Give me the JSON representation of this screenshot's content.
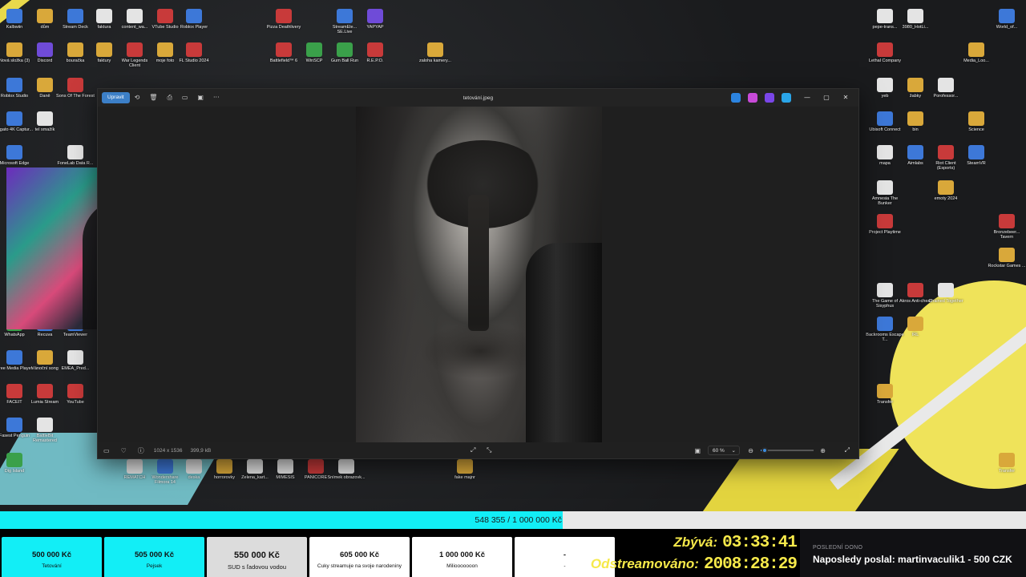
{
  "desktop": {
    "icons": [
      {
        "label": "Kalbwiin",
        "color": "blue"
      },
      {
        "label": "dům",
        "color": "folder"
      },
      {
        "label": "Stream Deck",
        "color": "blue"
      },
      {
        "label": "faktura",
        "color": "white"
      },
      {
        "label": "content_wa...",
        "color": "white"
      },
      {
        "label": "VTube Studio",
        "color": "red"
      },
      {
        "label": "Roblox Player",
        "color": "blue"
      },
      {
        "label": "Pizza Deathlivery",
        "color": "red"
      },
      {
        "label": "StreamEle... SE.Live",
        "color": "blue"
      },
      {
        "label": "YAPYAP",
        "color": "purple"
      },
      {
        "label": "Nová složka (3)",
        "color": "folder"
      },
      {
        "label": "Discord",
        "color": "purple"
      },
      {
        "label": "bouračka",
        "color": "folder"
      },
      {
        "label": "faktury",
        "color": "folder"
      },
      {
        "label": "War Legends Client",
        "color": "red"
      },
      {
        "label": "moje foto",
        "color": "folder"
      },
      {
        "label": "FL Studio 2024",
        "color": "red"
      },
      {
        "label": "Battlefield™ 6",
        "color": "red"
      },
      {
        "label": "WinSCP",
        "color": "green"
      },
      {
        "label": "Gum Ball Run",
        "color": "green"
      },
      {
        "label": "R.E.P.O.",
        "color": "red"
      },
      {
        "label": "zaloha kamery...",
        "color": "folder"
      },
      {
        "label": "Roblox Studio",
        "color": "blue"
      },
      {
        "label": "Daně",
        "color": "folder"
      },
      {
        "label": "Sons Of The Forest",
        "color": "red"
      },
      {
        "label": "Elgato 4K Captur...",
        "color": "blue"
      },
      {
        "label": "tel smažík",
        "color": "white"
      },
      {
        "label": "Microsoft Edge",
        "color": "blue"
      },
      {
        "label": "FoneLab Data R...",
        "color": "white"
      },
      {
        "label": "Snaz",
        "color": "white"
      },
      {
        "label": "WhatsApp",
        "color": "green"
      },
      {
        "label": "Recuva",
        "color": "blue"
      },
      {
        "label": "TeamViewer",
        "color": "blue"
      },
      {
        "label": "Free Media Player",
        "color": "blue"
      },
      {
        "label": "Vánoční song",
        "color": "folder"
      },
      {
        "label": "EMEA_Pred...",
        "color": "white"
      },
      {
        "label": "FACEIT",
        "color": "red"
      },
      {
        "label": "Lumia Stream",
        "color": "red"
      },
      {
        "label": "YouTube",
        "color": "red"
      },
      {
        "label": "Fasest Penguin",
        "color": "blue"
      },
      {
        "label": "BattleBit Remastered",
        "color": "white"
      },
      {
        "label": "Dig Island",
        "color": "green"
      },
      {
        "label": "REMATCH",
        "color": "white"
      },
      {
        "label": "Wondershare Filmora 14",
        "color": "blue"
      },
      {
        "label": "deska",
        "color": "white"
      },
      {
        "label": "horrorovky",
        "color": "folder"
      },
      {
        "label": "Zelena_kart...",
        "color": "white"
      },
      {
        "label": "MIMESIS",
        "color": "white"
      },
      {
        "label": "PANICORE",
        "color": "red"
      },
      {
        "label": "Snímek obrazovk...",
        "color": "white"
      },
      {
        "label": "fake majnr",
        "color": "folder"
      },
      {
        "label": "pepe-trans...",
        "color": "white"
      },
      {
        "label": "3980_HotLi...",
        "color": "white"
      },
      {
        "label": "World_of...",
        "color": "blue"
      },
      {
        "label": "Lethal Company",
        "color": "red"
      },
      {
        "label": "Media_Loo...",
        "color": "folder"
      },
      {
        "label": "yeb",
        "color": "white"
      },
      {
        "label": "žabky",
        "color": "folder"
      },
      {
        "label": "Porofessor...",
        "color": "white"
      },
      {
        "label": "Ubisoft Connect",
        "color": "blue"
      },
      {
        "label": "bin",
        "color": "folder"
      },
      {
        "label": "Science",
        "color": "folder"
      },
      {
        "label": "mapa",
        "color": "white"
      },
      {
        "label": "Aimlabs",
        "color": "blue"
      },
      {
        "label": "Riot Client (Esports)",
        "color": "red"
      },
      {
        "label": "SteamVR",
        "color": "blue"
      },
      {
        "label": "Amnesia The Bunker",
        "color": "white"
      },
      {
        "label": "emoty 2024",
        "color": "folder"
      },
      {
        "label": "Project Playtime",
        "color": "red"
      },
      {
        "label": "Bronzebeer... Tavern",
        "color": "red"
      },
      {
        "label": "Rockstar Games ...",
        "color": "folder"
      },
      {
        "label": "The Game of Sisyphus",
        "color": "white"
      },
      {
        "label": "Akros Anti-cheat",
        "color": "red"
      },
      {
        "label": "Chained Together",
        "color": "white"
      },
      {
        "label": "Backrooms Escape T...",
        "color": "blue"
      },
      {
        "label": "IRL",
        "color": "folder"
      },
      {
        "label": "Transfer",
        "color": "folder"
      },
      {
        "label": "Transfer",
        "color": "folder"
      }
    ]
  },
  "photos_app": {
    "edit_label": "Upravit",
    "file_name": "tetování.jpeg",
    "toolbar": {
      "rotate": "⟲",
      "delete": "🗑",
      "print": "⎙",
      "crop": "▭",
      "info": "▣",
      "more": "···"
    },
    "window_controls": {
      "minimize": "—",
      "maximize": "▢",
      "close": "✕"
    },
    "app_badge_colors": [
      "#2c84e0",
      "#c84ad8",
      "#7a46e8",
      "#2aa5e8"
    ],
    "status": {
      "filmstrip": "▭",
      "favorite": "♡",
      "info": "ⓘ",
      "dimensions": "1024 x 1536",
      "file_size": "399,9 kB",
      "fit": "⤢",
      "compare": "⤡",
      "zoom_percent": "60 %",
      "zoom_dropdown": "⌄",
      "zoom_out": "⊖",
      "zoom_in": "⊕",
      "fullscreen": "⤢",
      "zoom_level": 0.08
    }
  },
  "donation_goal": {
    "raised_text": "548 355 / 1 000 000 Kč",
    "progress_fraction": 0.548355,
    "milestones": [
      {
        "amount": "500 000 Kč",
        "name": "Tetování",
        "state": "done"
      },
      {
        "amount": "505 000 Kč",
        "name": "Pejsek",
        "state": "done"
      },
      {
        "amount": "550 000 Kč",
        "name": "SUD s ľadovou vodou",
        "state": "current"
      },
      {
        "amount": "605 000 Kč",
        "name": "Cuky streamuje na svoje narodeniny",
        "state": "upcoming"
      },
      {
        "amount": "1 000 000 Kč",
        "name": "Miliooooooon",
        "state": "upcoming"
      },
      {
        "amount": "-",
        "name": "-",
        "state": "upcoming"
      }
    ]
  },
  "timers": {
    "remaining_label": "Zbývá:",
    "remaining_value": "03:33:41",
    "streamed_label": "Odstreamováno:",
    "streamed_value": "2008:28:29"
  },
  "last_donation": {
    "caption": "POSLEDNÍ DONO",
    "message": "Naposledy poslal: martinvaculik1 - 500 CZK"
  },
  "colors": {
    "accent_cyan": "#12eef6",
    "timer_yellow": "#f6e94a",
    "edit_blue": "#3c7fc7"
  }
}
